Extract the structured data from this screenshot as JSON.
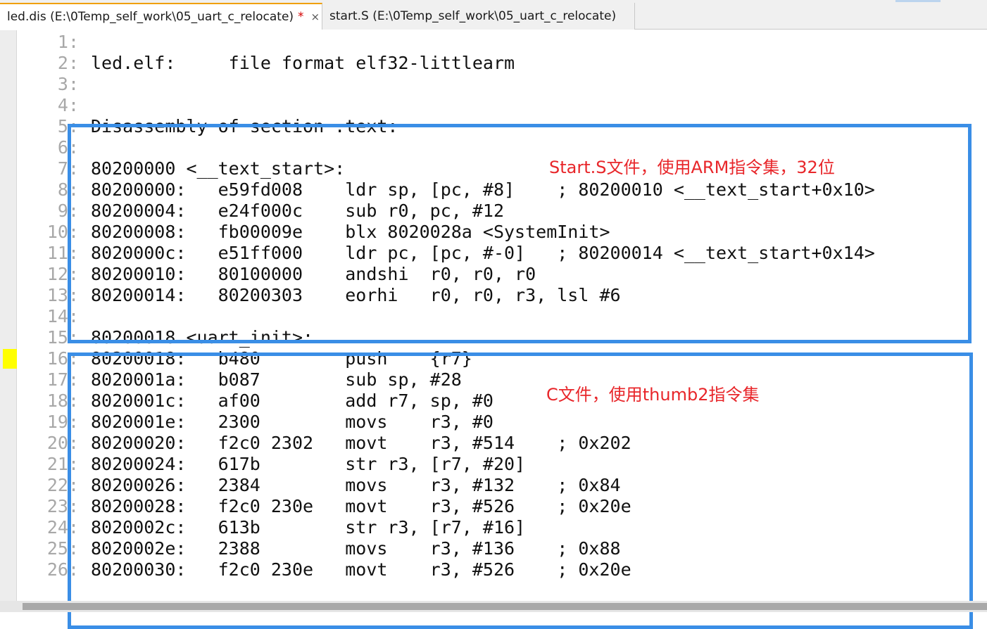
{
  "tabs": [
    {
      "label": "led.dis (E:\\0Temp_self_work\\05_uart_c_relocate)",
      "modified": "*",
      "close": "×"
    },
    {
      "label": "start.S (E:\\0Temp_self_work\\05_uart_c_relocate)"
    }
  ],
  "lines": [
    {
      "num": "1:",
      "text": ""
    },
    {
      "num": "2:",
      "text": "led.elf:     file format elf32-littlearm"
    },
    {
      "num": "3:",
      "text": ""
    },
    {
      "num": "4:",
      "text": ""
    },
    {
      "num": "5:",
      "text": "Disassembly of section .text:"
    },
    {
      "num": "6:",
      "text": ""
    },
    {
      "num": "7:",
      "text": "80200000 <__text_start>:"
    },
    {
      "num": "8:",
      "text": "80200000:   e59fd008    ldr sp, [pc, #8]    ; 80200010 <__text_start+0x10>"
    },
    {
      "num": "9:",
      "text": "80200004:   e24f000c    sub r0, pc, #12"
    },
    {
      "num": "10:",
      "text": "80200008:   fb00009e    blx 8020028a <SystemInit>"
    },
    {
      "num": "11:",
      "text": "8020000c:   e51ff000    ldr pc, [pc, #-0]   ; 80200014 <__text_start+0x14>"
    },
    {
      "num": "12:",
      "text": "80200010:   80100000    andshi  r0, r0, r0"
    },
    {
      "num": "13:",
      "text": "80200014:   80200303    eorhi   r0, r0, r3, lsl #6"
    },
    {
      "num": "14:",
      "text": ""
    },
    {
      "num": "15:",
      "text": "80200018 <uart_init>:"
    },
    {
      "num": "16:",
      "text": "80200018:   b480        push    {r7}"
    },
    {
      "num": "17:",
      "text": "8020001a:   b087        sub sp, #28"
    },
    {
      "num": "18:",
      "text": "8020001c:   af00        add r7, sp, #0"
    },
    {
      "num": "19:",
      "text": "8020001e:   2300        movs    r3, #0"
    },
    {
      "num": "20:",
      "text": "80200020:   f2c0 2302   movt    r3, #514    ; 0x202"
    },
    {
      "num": "21:",
      "text": "80200024:   617b        str r3, [r7, #20]"
    },
    {
      "num": "22:",
      "text": "80200026:   2384        movs    r3, #132    ; 0x84"
    },
    {
      "num": "23:",
      "text": "80200028:   f2c0 230e   movt    r3, #526    ; 0x20e"
    },
    {
      "num": "24:",
      "text": "8020002c:   613b        str r3, [r7, #16]"
    },
    {
      "num": "25:",
      "text": "8020002e:   2388        movs    r3, #136    ; 0x88"
    },
    {
      "num": "26:",
      "text": "80200030:   f2c0 230e   movt    r3, #526    ; 0x20e"
    }
  ],
  "annotations": {
    "arm_note": "Start.S文件，使用ARM指令集，32位",
    "thumb_note": "C文件，使用thumb2指令集"
  },
  "colors": {
    "box_border": "#3a8ee6",
    "note_text": "#e8262a",
    "current_line_marker": "#ffff00"
  }
}
